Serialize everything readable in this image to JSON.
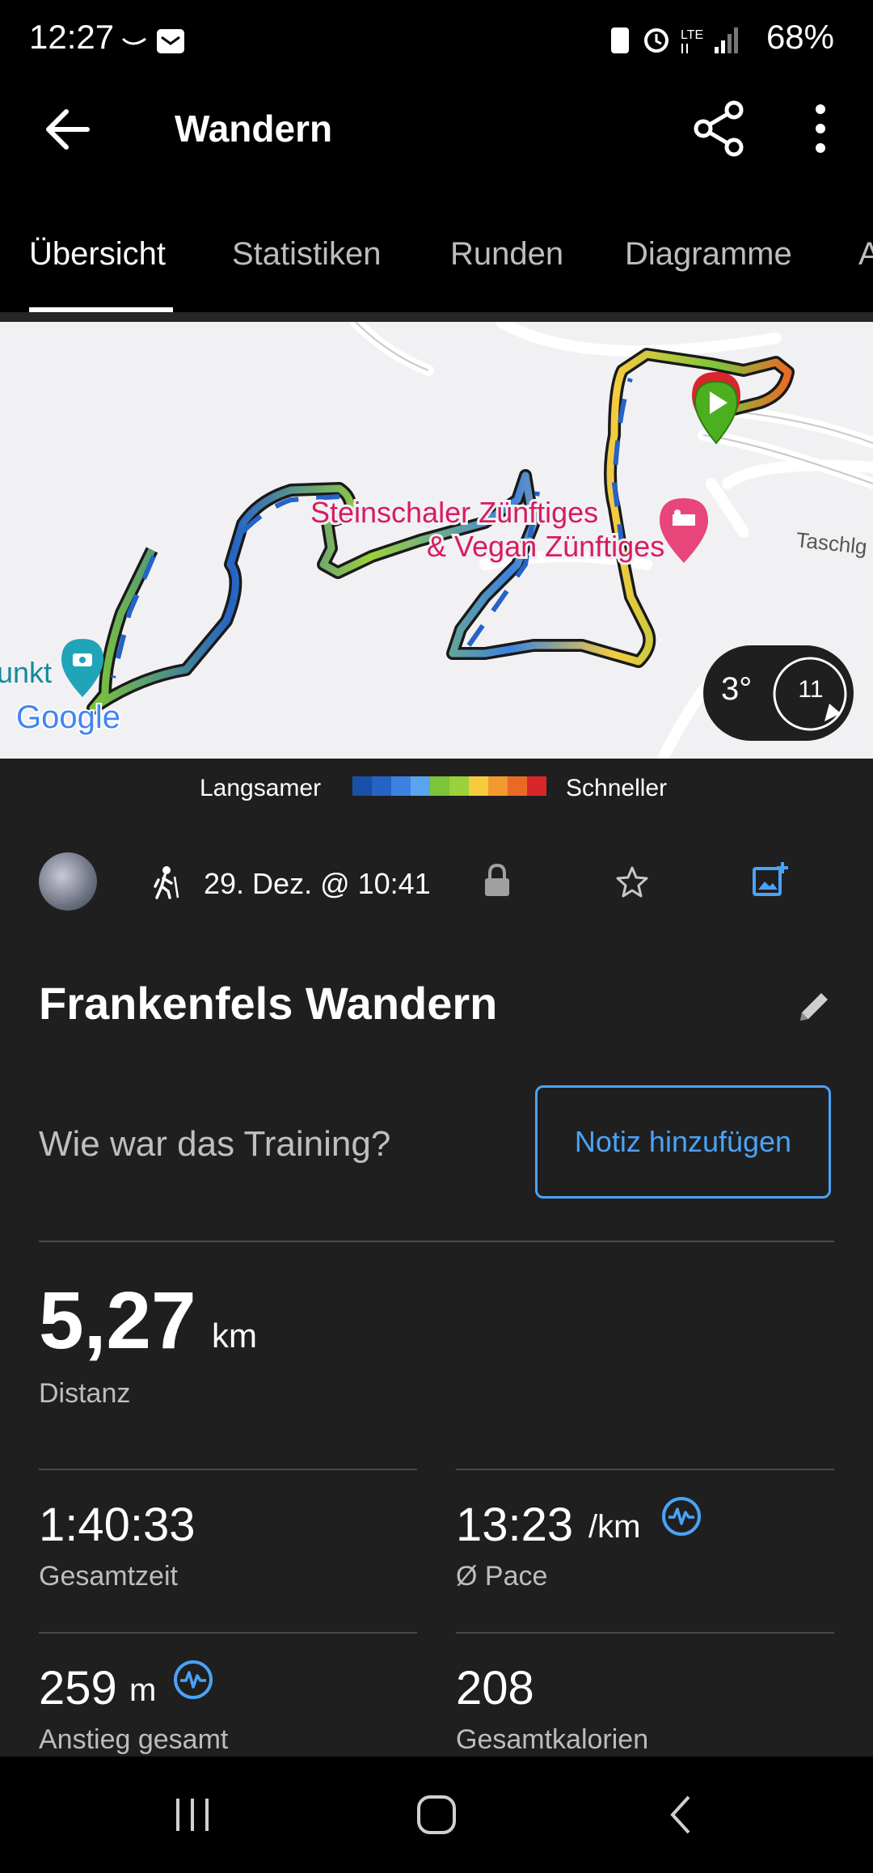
{
  "status": {
    "time": "12:27",
    "network": "LTE",
    "battery": "68%"
  },
  "header": {
    "title": "Wandern"
  },
  "tabs": [
    {
      "label": "Übersicht"
    },
    {
      "label": "Statistiken"
    },
    {
      "label": "Runden"
    },
    {
      "label": "Diagramme"
    },
    {
      "label": "A"
    }
  ],
  "map": {
    "poi_name_line1": "Steinschaler Zünftiges",
    "poi_name_line2": "& Vegan Zünftiges",
    "road_label": "Taschlg",
    "left_label": "unkt",
    "attribution": "Google",
    "weather_temp": "3°",
    "wind_speed": "11"
  },
  "legend": {
    "slower_label": "Langsamer",
    "faster_label": "Schneller",
    "colors": [
      "#1a4fa8",
      "#2563c6",
      "#3d82e0",
      "#59a5f0",
      "#7dc43a",
      "#9bd13a",
      "#f6cc3f",
      "#f29a2e",
      "#ea6a25",
      "#d8262b"
    ]
  },
  "activity": {
    "date": "29. Dez. @ 10:41",
    "name": "Frankenfels Wandern",
    "note_prompt": "Wie war das Training?",
    "note_button": "Notiz hinzufügen"
  },
  "stats": {
    "distance": {
      "value": "5,27",
      "unit": "km",
      "label": "Distanz"
    },
    "total_time": {
      "value": "1:40:33",
      "label": "Gesamtzeit"
    },
    "pace": {
      "value": "13:23",
      "unit": "/km",
      "label": "Ø Pace"
    },
    "ascent": {
      "value": "259",
      "unit": "m",
      "label": "Anstieg gesamt"
    },
    "calories": {
      "value": "208",
      "label": "Gesamtkalorien"
    }
  },
  "colors": {
    "accent": "#4aa3f7",
    "poi": "#d81b60",
    "start_marker": "#4caf1f"
  }
}
